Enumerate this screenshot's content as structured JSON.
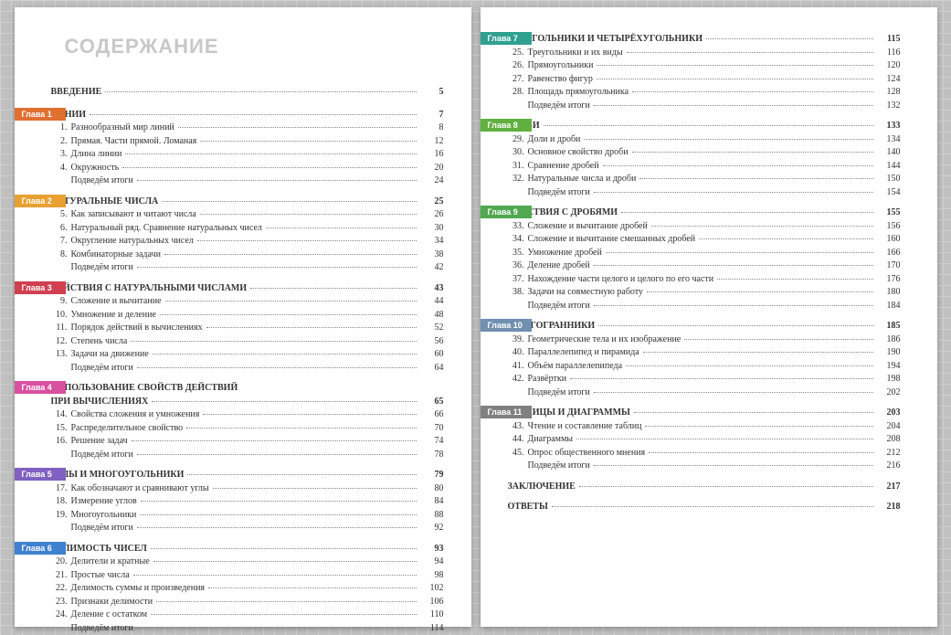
{
  "title": "СОДЕРЖАНИЕ",
  "intro": {
    "label": "ВВЕДЕНИЕ",
    "page": "5"
  },
  "chapters": [
    {
      "n": "Глава 1",
      "color": "#e07030",
      "title": "ЛИНИИ",
      "page": "7",
      "items": [
        {
          "n": "1.",
          "t": "Разнообразный мир линий",
          "p": "8"
        },
        {
          "n": "2.",
          "t": "Прямая. Части прямой. Ломаная",
          "p": "12"
        },
        {
          "n": "3.",
          "t": "Длина линии",
          "p": "16"
        },
        {
          "n": "4.",
          "t": "Окружность",
          "p": "20"
        },
        {
          "n": "",
          "t": "Подведём итоги",
          "p": "24"
        }
      ]
    },
    {
      "n": "Глава 2",
      "color": "#e8a030",
      "title": "НАТУРАЛЬНЫЕ ЧИСЛА",
      "page": "25",
      "items": [
        {
          "n": "5.",
          "t": "Как записывают и читают числа",
          "p": "26"
        },
        {
          "n": "6.",
          "t": "Натуральный ряд. Сравнение натуральных чисел",
          "p": "30"
        },
        {
          "n": "7.",
          "t": "Округление натуральных чисел",
          "p": "34"
        },
        {
          "n": "8.",
          "t": "Комбинаторные задачи",
          "p": "38"
        },
        {
          "n": "",
          "t": "Подведём итоги",
          "p": "42"
        }
      ]
    },
    {
      "n": "Глава 3",
      "color": "#d04050",
      "title": "ДЕЙСТВИЯ С НАТУРАЛЬНЫМИ ЧИСЛАМИ",
      "page": "43",
      "items": [
        {
          "n": "9.",
          "t": "Сложение и вычитание",
          "p": "44"
        },
        {
          "n": "10.",
          "t": "Умножение и деление",
          "p": "48"
        },
        {
          "n": "11.",
          "t": "Порядок действий в вычислениях",
          "p": "52"
        },
        {
          "n": "12.",
          "t": "Степень числа",
          "p": "56"
        },
        {
          "n": "13.",
          "t": "Задачи на движение",
          "p": "60"
        },
        {
          "n": "",
          "t": "Подведём итоги",
          "p": "64"
        }
      ]
    },
    {
      "n": "Глава 4",
      "color": "#d850a0",
      "title": "ИСПОЛЬЗОВАНИЕ СВОЙСТВ ДЕЙСТВИЙ",
      "title2": "ПРИ ВЫЧИСЛЕНИЯХ",
      "page": "65",
      "items": [
        {
          "n": "14.",
          "t": "Свойства сложения и умножения",
          "p": "66"
        },
        {
          "n": "15.",
          "t": "Распределительное свойство",
          "p": "70"
        },
        {
          "n": "16.",
          "t": "Решение задач",
          "p": "74"
        },
        {
          "n": "",
          "t": "Подведём итоги",
          "p": "78"
        }
      ]
    },
    {
      "n": "Глава 5",
      "color": "#8060c0",
      "title": "УГЛЫ И МНОГОУГОЛЬНИКИ",
      "page": "79",
      "items": [
        {
          "n": "17.",
          "t": "Как обозначают и сравнивают углы",
          "p": "80"
        },
        {
          "n": "18.",
          "t": "Измерение углов",
          "p": "84"
        },
        {
          "n": "19.",
          "t": "Многоугольники",
          "p": "88"
        },
        {
          "n": "",
          "t": "Подведём итоги",
          "p": "92"
        }
      ]
    },
    {
      "n": "Глава 6",
      "color": "#4080d0",
      "title": "ДЕЛИМОСТЬ ЧИСЕЛ",
      "page": "93",
      "items": [
        {
          "n": "20.",
          "t": "Делители и кратные",
          "p": "94"
        },
        {
          "n": "21.",
          "t": "Простые числа",
          "p": "98"
        },
        {
          "n": "22.",
          "t": "Делимость суммы и произведения",
          "p": "102"
        },
        {
          "n": "23.",
          "t": "Признаки делимости",
          "p": "106"
        },
        {
          "n": "24.",
          "t": "Деление с остатком",
          "p": "110"
        },
        {
          "n": "",
          "t": "Подведём итоги",
          "p": "114"
        }
      ]
    },
    {
      "n": "Глава 7",
      "color": "#30a090",
      "title": "ТРЕУГОЛЬНИКИ И ЧЕТЫРЁХУГОЛЬНИКИ",
      "page": "115",
      "items": [
        {
          "n": "25.",
          "t": "Треугольники и их виды",
          "p": "116"
        },
        {
          "n": "26.",
          "t": "Прямоугольники",
          "p": "120"
        },
        {
          "n": "27.",
          "t": "Равенство фигур",
          "p": "124"
        },
        {
          "n": "28.",
          "t": "Площадь прямоугольника",
          "p": "128"
        },
        {
          "n": "",
          "t": "Подведём итоги",
          "p": "132"
        }
      ]
    },
    {
      "n": "Глава 8",
      "color": "#60b040",
      "title": "ДРОБИ",
      "page": "133",
      "items": [
        {
          "n": "29.",
          "t": "Доли и дроби",
          "p": "134"
        },
        {
          "n": "30.",
          "t": "Основное свойство дроби",
          "p": "140"
        },
        {
          "n": "31.",
          "t": "Сравнение дробей",
          "p": "144"
        },
        {
          "n": "32.",
          "t": "Натуральные числа и дроби",
          "p": "150"
        },
        {
          "n": "",
          "t": "Подведём итоги",
          "p": "154"
        }
      ]
    },
    {
      "n": "Глава 9",
      "color": "#50a850",
      "title": "ДЕЙСТВИЯ С ДРОБЯМИ",
      "page": "155",
      "items": [
        {
          "n": "33.",
          "t": "Сложение и вычитание дробей",
          "p": "156"
        },
        {
          "n": "34.",
          "t": "Сложение и вычитание смешанных дробей",
          "p": "160"
        },
        {
          "n": "35.",
          "t": "Умножение дробей",
          "p": "166"
        },
        {
          "n": "36.",
          "t": "Деление дробей",
          "p": "170"
        },
        {
          "n": "37.",
          "t": "Нахождение части целого и целого по его части",
          "p": "176"
        },
        {
          "n": "38.",
          "t": "Задачи на совместную работу",
          "p": "180"
        },
        {
          "n": "",
          "t": "Подведём итоги",
          "p": "184"
        }
      ]
    },
    {
      "n": "Глава 10",
      "color": "#7090b0",
      "title": "МНОГОГРАННИКИ",
      "page": "185",
      "items": [
        {
          "n": "39.",
          "t": "Геометрические тела и их изображение",
          "p": "186"
        },
        {
          "n": "40.",
          "t": "Параллелепипед и пирамида",
          "p": "190"
        },
        {
          "n": "41.",
          "t": "Объём параллелепипеда",
          "p": "194"
        },
        {
          "n": "42.",
          "t": "Развёртки",
          "p": "198"
        },
        {
          "n": "",
          "t": "Подведём итоги",
          "p": "202"
        }
      ]
    },
    {
      "n": "Глава 11",
      "color": "#808080",
      "title": "ТАБЛИЦЫ И ДИАГРАММЫ",
      "page": "203",
      "items": [
        {
          "n": "43.",
          "t": "Чтение и составление таблиц",
          "p": "204"
        },
        {
          "n": "44.",
          "t": "Диаграммы",
          "p": "208"
        },
        {
          "n": "45.",
          "t": "Опрос общественного мнения",
          "p": "212"
        },
        {
          "n": "",
          "t": "Подведём итоги",
          "p": "216"
        }
      ]
    }
  ],
  "closing": [
    {
      "label": "ЗАКЛЮЧЕНИЕ",
      "page": "217"
    },
    {
      "label": "ОТВЕТЫ",
      "page": "218"
    }
  ]
}
